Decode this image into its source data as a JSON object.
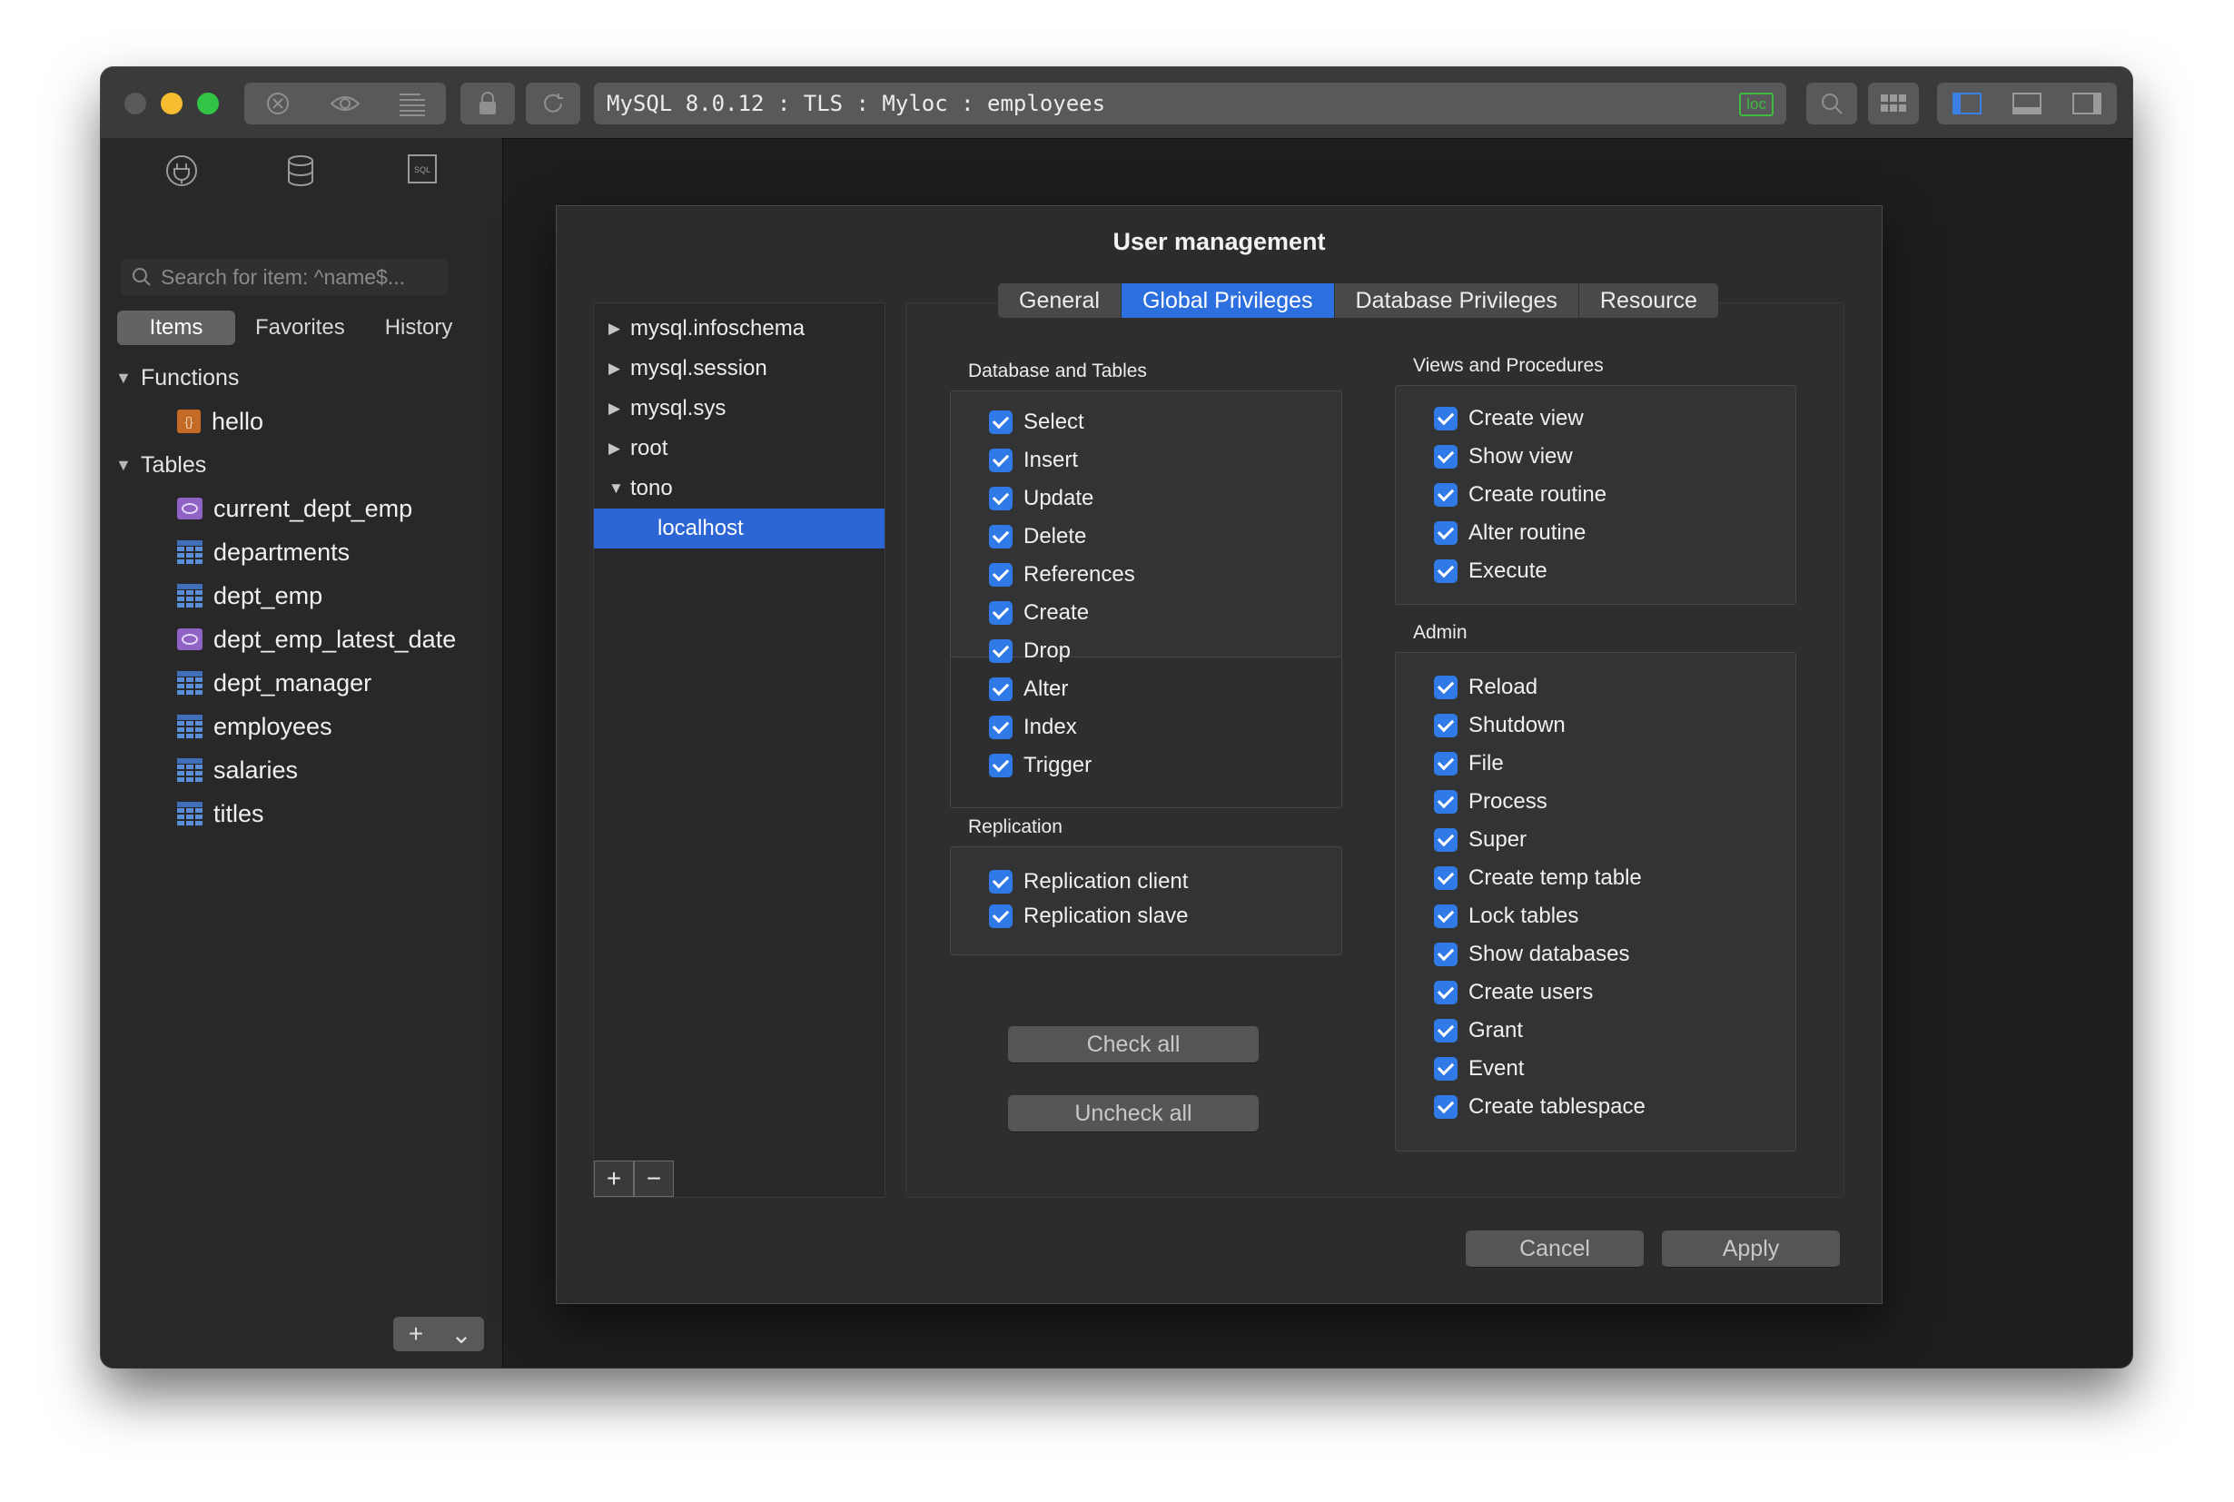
{
  "toolbar": {
    "connection_label": "MySQL 8.0.12 : TLS : Myloc : employees",
    "env_badge": "loc",
    "env_badge_color": "#3dbb3d"
  },
  "sidebar": {
    "search_placeholder": "Search for item: ^name$...",
    "tabs": [
      {
        "label": "Items",
        "active": true
      },
      {
        "label": "Favorites",
        "active": false
      },
      {
        "label": "History",
        "active": false
      }
    ],
    "groups": [
      {
        "label": "Functions",
        "items": [
          {
            "label": "hello",
            "icon": "function-icon"
          }
        ]
      },
      {
        "label": "Tables",
        "items": [
          {
            "label": "current_dept_emp",
            "icon": "view-icon"
          },
          {
            "label": "departments",
            "icon": "table-icon"
          },
          {
            "label": "dept_emp",
            "icon": "table-icon"
          },
          {
            "label": "dept_emp_latest_date",
            "icon": "view-icon"
          },
          {
            "label": "dept_manager",
            "icon": "table-icon"
          },
          {
            "label": "employees",
            "icon": "table-icon"
          },
          {
            "label": "salaries",
            "icon": "table-icon"
          },
          {
            "label": "titles",
            "icon": "table-icon"
          }
        ]
      }
    ]
  },
  "dialog": {
    "title": "User management",
    "users": [
      {
        "label": "mysql.infoschema",
        "expanded": false
      },
      {
        "label": "mysql.session",
        "expanded": false
      },
      {
        "label": "mysql.sys",
        "expanded": false
      },
      {
        "label": "root",
        "expanded": false
      },
      {
        "label": "tono",
        "expanded": true
      },
      {
        "label": "localhost",
        "selected": true
      }
    ],
    "tabs": [
      {
        "label": "General",
        "active": false
      },
      {
        "label": "Global Privileges",
        "active": true
      },
      {
        "label": "Database Privileges",
        "active": false
      },
      {
        "label": "Resource",
        "active": false
      }
    ],
    "groups": {
      "db_tables": {
        "title": "Database and Tables",
        "items": [
          "Select",
          "Insert",
          "Update",
          "Delete",
          "References",
          "Create",
          "Drop",
          "Alter",
          "Index",
          "Trigger"
        ]
      },
      "replication": {
        "title": "Replication",
        "items": [
          "Replication client",
          "Replication slave"
        ]
      },
      "views_procedures": {
        "title": "Views and Procedures",
        "items": [
          "Create view",
          "Show view",
          "Create routine",
          "Alter routine",
          "Execute"
        ]
      },
      "admin": {
        "title": "Admin",
        "items": [
          "Reload",
          "Shutdown",
          "File",
          "Process",
          "Super",
          "Create temp table",
          "Lock tables",
          "Show databases",
          "Create users",
          "Grant",
          "Event",
          "Create tablespace"
        ]
      }
    },
    "check_all_label": "Check all",
    "uncheck_all_label": "Uncheck all",
    "cancel_label": "Cancel",
    "apply_label": "Apply",
    "add_symbol": "+",
    "remove_symbol": "−"
  },
  "colors": {
    "accent": "#2e6fe0",
    "selection": "#2c65d4",
    "checkbox": "#2f7ae6"
  }
}
